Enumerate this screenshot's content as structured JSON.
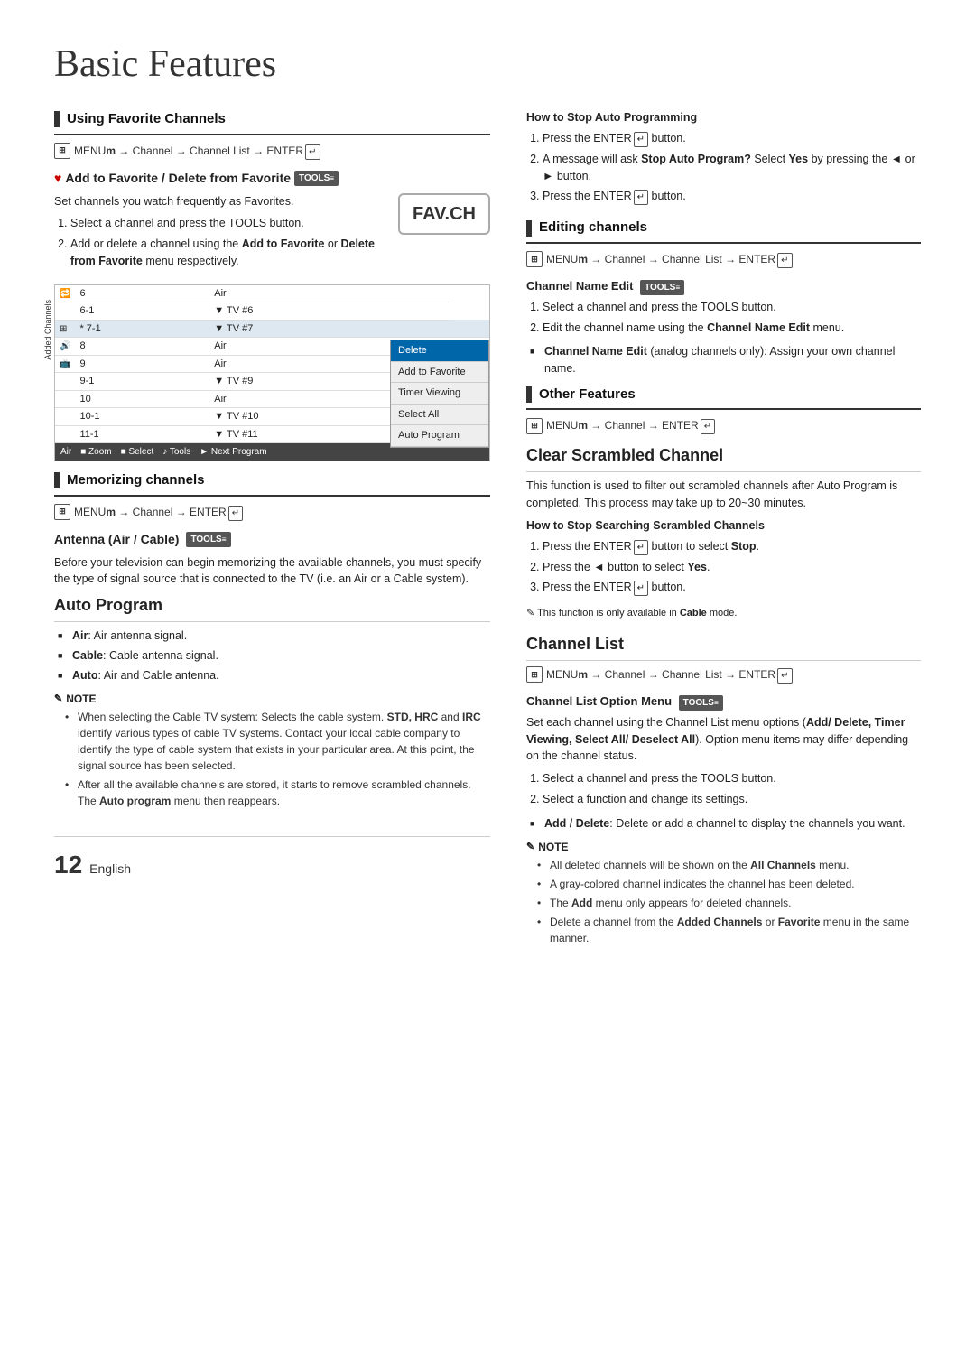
{
  "page": {
    "title": "Basic Features",
    "page_number": "12",
    "language": "English"
  },
  "left_col": {
    "section1": {
      "title": "Using Favorite Channels",
      "menu_path": "MENU  → Channel → Channel List → ENTER"
    },
    "subsection_add_favorite": {
      "title": "Add to Favorite / Delete from Favorite",
      "tools_label": "TOOLS",
      "intro": "Set channels you watch frequently as Favorites.",
      "step1": "Select a channel and press the TOOLS button.",
      "step2": "Add or delete a channel using the Add to Favorite or Delete from Favorite menu respectively.",
      "fav_ch": "FAV.CH",
      "table": {
        "rows": [
          [
            "",
            "6",
            "Air",
            ""
          ],
          [
            "",
            "6-1",
            "▼ TV #6",
            ""
          ],
          [
            "",
            "* 7-1",
            "▼ TV #7",
            ""
          ],
          [
            "",
            "8",
            "Air",
            ""
          ],
          [
            "",
            "9",
            "Air",
            ""
          ],
          [
            "",
            "9-1",
            "▼ TV #9",
            ""
          ],
          [
            "",
            "10",
            "Air",
            ""
          ],
          [
            "",
            "10-1",
            "▼ TV #10",
            ""
          ],
          [
            "",
            "11-1",
            "▼ TV #11",
            ""
          ]
        ],
        "context_menu": [
          "Delete",
          "Add to Favorite",
          "Timer Viewing",
          "Select All",
          "Auto Program"
        ],
        "footer": [
          "Air",
          "■ Zoom",
          "■ Select",
          "♪ Tools",
          "► Next Program"
        ],
        "added_channels_label": "Added Channels"
      }
    },
    "section2": {
      "title": "Memorizing channels",
      "menu_path": "MENU  → Channel → ENTER"
    },
    "section3": {
      "title": "Antenna (Air / Cable)",
      "tools_label": "TOOLS",
      "description": "Before your television can begin memorizing the available channels, you must specify the type of signal source that is connected to the TV (i.e. an Air or a Cable system)."
    },
    "section4": {
      "title": "Auto Program",
      "bullets": [
        {
          "label": "Air:",
          "text": "Air antenna signal."
        },
        {
          "label": "Cable:",
          "text": "Cable antenna signal."
        },
        {
          "label": "Auto:",
          "text": "Air and Cable antenna."
        }
      ],
      "note_label": "NOTE",
      "notes": [
        "When selecting the Cable TV system: Selects the cable system. STD, HRC and IRC identify various types of cable TV systems. Contact your local cable company to identify the type of cable system that exists in your particular area. At this point, the signal source has been selected.",
        "After all the available channels are stored, it starts to remove scrambled channels. The Auto program menu then reappears."
      ]
    }
  },
  "right_col": {
    "how_to_stop_auto": {
      "title": "How to Stop Auto Programming",
      "steps": [
        "Press the ENTER  button.",
        "A message will ask Stop Auto Program? Select Yes by pressing the ◄ or ► button.",
        "Press the ENTER  button."
      ]
    },
    "section_editing": {
      "title": "Editing channels",
      "menu_path": "MENU  → Channel → Channel List → ENTER",
      "subsection": {
        "title": "Channel Name Edit",
        "tools_label": "TOOLS",
        "steps": [
          "Select a channel and press the TOOLS button.",
          "Edit the channel name using the Channel Name Edit menu."
        ],
        "note": "Channel Name Edit (analog channels only): Assign your own channel name."
      }
    },
    "section_other": {
      "title": "Other Features",
      "menu_path": "MENU  → Channel → ENTER"
    },
    "section_clear": {
      "title": "Clear Scrambled Channel",
      "description": "This function is used to filter out scrambled channels after Auto Program is completed. This process may take up to 20~30 minutes.",
      "how_to_stop": {
        "title": "How to Stop Searching Scrambled Channels",
        "steps": [
          "Press the ENTER  button to select Stop.",
          "Press the ◄ button to select Yes.",
          "Press the ENTER  button."
        ],
        "note": "This function is only available in Cable mode."
      }
    },
    "section_channel_list": {
      "title": "Channel List",
      "menu_path": "MENU  → Channel → Channel List → ENTER",
      "subsection": {
        "title": "Channel List Option Menu",
        "tools_label": "TOOLS",
        "description": "Set each channel using the Channel List menu options (Add/ Delete, Timer Viewing, Select All/ Deselect All). Option menu items may differ depending on the channel status.",
        "steps": [
          "Select a channel and press the TOOLS button.",
          "Select a function and change its settings."
        ],
        "bullet_add_delete": "Add / Delete: Delete or add a channel to display the channels you want.",
        "note_label": "NOTE",
        "notes": [
          "All deleted channels will be shown on the All Channels menu.",
          "A gray-colored channel indicates the channel has been deleted.",
          "The Add menu only appears for deleted channels.",
          "Delete a channel from the Added Channels or Favorite menu in the same manner."
        ]
      }
    }
  }
}
